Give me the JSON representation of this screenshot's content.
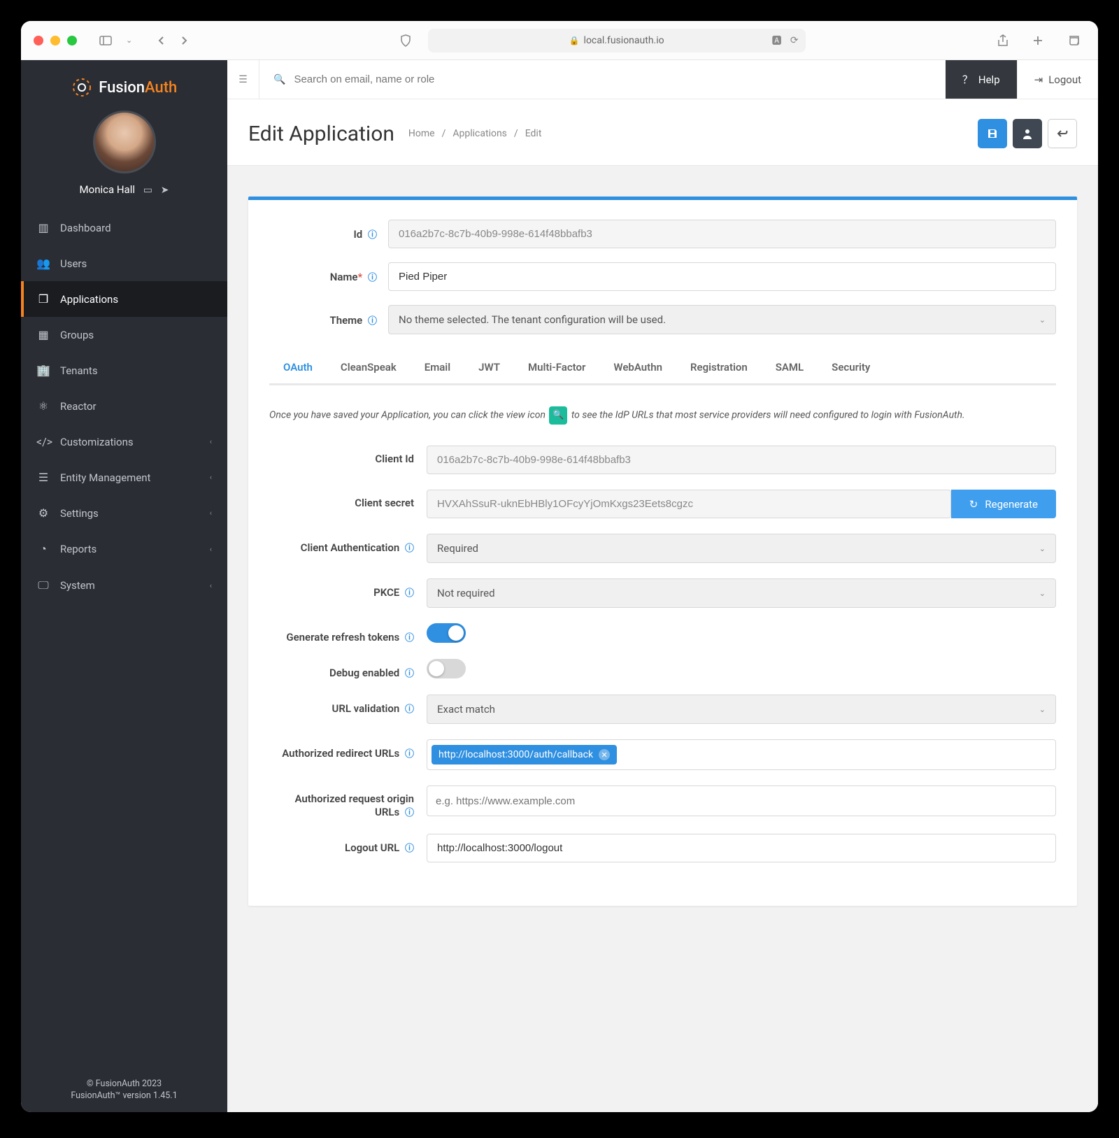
{
  "browser": {
    "url_host": "local.fusionauth.io"
  },
  "brand": {
    "part1": "Fusion",
    "part2": "Auth"
  },
  "user": {
    "name": "Monica Hall"
  },
  "sidebar": {
    "items": [
      {
        "label": "Dashboard",
        "icon": "dashboard"
      },
      {
        "label": "Users",
        "icon": "users"
      },
      {
        "label": "Applications",
        "icon": "cube",
        "active": true
      },
      {
        "label": "Groups",
        "icon": "groups"
      },
      {
        "label": "Tenants",
        "icon": "building"
      },
      {
        "label": "Reactor",
        "icon": "atom"
      },
      {
        "label": "Customizations",
        "icon": "code",
        "expandable": true
      },
      {
        "label": "Entity Management",
        "icon": "list",
        "expandable": true
      },
      {
        "label": "Settings",
        "icon": "sliders",
        "expandable": true
      },
      {
        "label": "Reports",
        "icon": "pie",
        "expandable": true
      },
      {
        "label": "System",
        "icon": "monitor",
        "expandable": true
      }
    ],
    "footer1": "© FusionAuth 2023",
    "footer2": "FusionAuth™ version 1.45.1"
  },
  "topbar": {
    "search_placeholder": "Search on email, name or role",
    "help": "Help",
    "logout": "Logout"
  },
  "page": {
    "title": "Edit Application",
    "crumbs": [
      "Home",
      "Applications",
      "Edit"
    ]
  },
  "form": {
    "id_label": "Id",
    "id_value": "016a2b7c-8c7b-40b9-998e-614f48bbafb3",
    "name_label": "Name",
    "name_value": "Pied Piper",
    "theme_label": "Theme",
    "theme_value": "No theme selected. The tenant configuration will be used."
  },
  "tabs": [
    "OAuth",
    "CleanSpeak",
    "Email",
    "JWT",
    "Multi-Factor",
    "WebAuthn",
    "Registration",
    "SAML",
    "Security"
  ],
  "oauth": {
    "intro_pre": "Once you have saved your Application, you can click the view icon ",
    "intro_post": " to see the IdP URLs that most service providers will need configured to login with FusionAuth.",
    "client_id_label": "Client Id",
    "client_id_value": "016a2b7c-8c7b-40b9-998e-614f48bbafb3",
    "client_secret_label": "Client secret",
    "client_secret_value": "HVXAhSsuR-uknEbHBly1OFcyYjOmKxgs23Eets8cgzc",
    "regenerate": "Regenerate",
    "client_auth_label": "Client Authentication",
    "client_auth_value": "Required",
    "pkce_label": "PKCE",
    "pkce_value": "Not required",
    "refresh_label": "Generate refresh tokens",
    "debug_label": "Debug enabled",
    "url_validation_label": "URL validation",
    "url_validation_value": "Exact match",
    "redirect_label": "Authorized redirect URLs",
    "redirect_value": "http://localhost:3000/auth/callback",
    "origin_label": "Authorized request origin URLs",
    "origin_placeholder": "e.g. https://www.example.com",
    "logout_label": "Logout URL",
    "logout_value": "http://localhost:3000/logout"
  }
}
